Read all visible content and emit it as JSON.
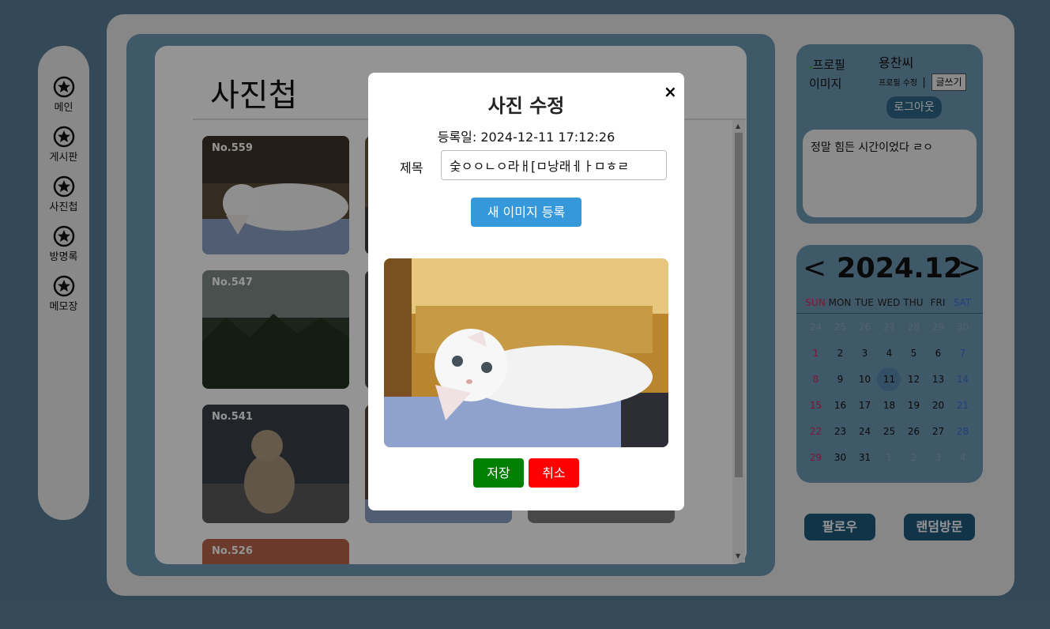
{
  "nav": {
    "items": [
      {
        "icon": "star-icon",
        "label": "메인"
      },
      {
        "icon": "star-icon",
        "label": "게시판"
      },
      {
        "icon": "star-icon",
        "label": "사진첩"
      },
      {
        "icon": "star-icon",
        "label": "방명록"
      },
      {
        "icon": "star-icon",
        "label": "메모장"
      }
    ]
  },
  "board": {
    "title": "사진첩",
    "photos": [
      {
        "no": "No.559"
      },
      {
        "no": "No.547"
      },
      {
        "no": "No.541"
      },
      {
        "no": "No.526"
      }
    ]
  },
  "profile": {
    "image_alt_1": "프로필",
    "image_alt_2": "이미지",
    "username": "용찬씨",
    "edit_link": "프로필 수정",
    "separator": "|",
    "write_button": "글쓰기",
    "logout_button": "로그아웃",
    "status": "정말 힘든 시간이었다 ㄹㅇ"
  },
  "calendar": {
    "prev": "<",
    "next": ">",
    "month_label": "2024.12",
    "weekdays": [
      "SUN",
      "MON",
      "TUE",
      "WED",
      "THU",
      "FRI",
      "SAT"
    ],
    "weeks": [
      [
        "24",
        "25",
        "26",
        "27",
        "28",
        "29",
        "30"
      ],
      [
        "1",
        "2",
        "3",
        "4",
        "5",
        "6",
        "7"
      ],
      [
        "8",
        "9",
        "10",
        "11",
        "12",
        "13",
        "14"
      ],
      [
        "15",
        "16",
        "17",
        "18",
        "19",
        "20",
        "21"
      ],
      [
        "22",
        "23",
        "24",
        "25",
        "26",
        "27",
        "28"
      ],
      [
        "29",
        "30",
        "31",
        "1",
        "2",
        "3",
        "4"
      ]
    ],
    "today": "11",
    "colors": {
      "sunday": "#e0245e",
      "saturday": "#3b6fd6",
      "other_month": "#8fa9ba"
    }
  },
  "actions": {
    "follow": "팔로우",
    "random_visit": "랜덤방문"
  },
  "modal": {
    "title": "사진 수정",
    "close": "×",
    "date_label": "등록일: 2024-12-11 17:12:26",
    "title_label": "제목",
    "title_value": "숯ㅇㅇㄴㅇ라ㅐ[ㅁ낭래ㅔㅏㅁㅎㄹ",
    "new_image_button": "새 이미지 등록",
    "save_button": "저장",
    "cancel_button": "취소"
  }
}
